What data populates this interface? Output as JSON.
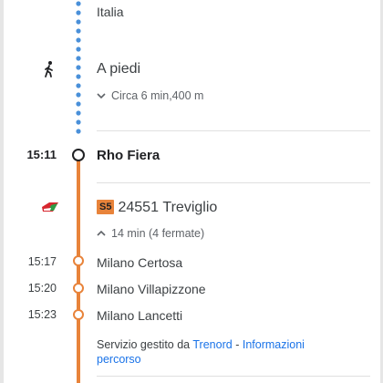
{
  "header": {
    "place": "Italia"
  },
  "walk": {
    "title": "A piedi",
    "detail": "Circa 6 min,400 m",
    "icon": "walk-icon"
  },
  "station": {
    "time": "15:11",
    "name": "Rho Fiera"
  },
  "train": {
    "badge": "S5",
    "number": "24551",
    "destination": "Treviglio",
    "duration": "14 min (4 fermate)",
    "icon": "train-icon"
  },
  "stops": [
    {
      "time": "15:17",
      "name": "Milano Certosa"
    },
    {
      "time": "15:20",
      "name": "Milano Villapizzone"
    },
    {
      "time": "15:23",
      "name": "Milano Lancetti"
    }
  ],
  "service": {
    "prefix": "Servizio gestito da",
    "operator": "Trenord",
    "separator": "-",
    "info_link_1": "Informazioni",
    "info_link_2": "percorso"
  },
  "colors": {
    "walk_dots": "#4a90d9",
    "train_line": "#e8833a",
    "link": "#1a73e8"
  }
}
